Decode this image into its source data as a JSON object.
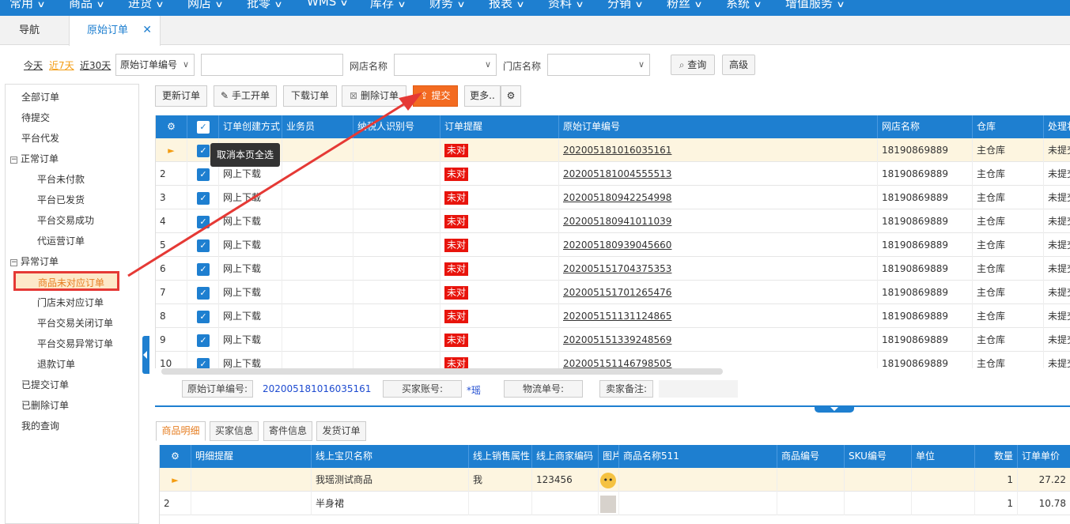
{
  "top_menu": [
    "常用",
    "商品",
    "进货",
    "网店",
    "批零",
    "WMS",
    "库存",
    "财务",
    "报表",
    "资料",
    "分销",
    "粉丝",
    "系统",
    "增值服务"
  ],
  "tabs": {
    "nav": "导航",
    "active": "原始订单",
    "close": "✕"
  },
  "filter": {
    "today": "今天",
    "last7": "近7天",
    "last30": "近30天",
    "field_select": "原始订单编号",
    "field_value": "",
    "shop_label": "网店名称",
    "store_label": "门店名称",
    "query": "查询",
    "advanced": "高级"
  },
  "sidebar": {
    "all": "全部订单",
    "pending": "待提交",
    "platform_proxy": "平台代发",
    "normal_group": "正常订单",
    "unpaid": "平台未付款",
    "shipped": "平台已发货",
    "success": "平台交易成功",
    "proxy_op": "代运营订单",
    "abnormal_group": "异常订单",
    "goods_unmatched": "商品未对应订单",
    "store_unmatched": "门店未对应订单",
    "closed": "平台交易关闭订单",
    "trade_abnormal": "平台交易异常订单",
    "refund": "退款订单",
    "submitted": "已提交订单",
    "deleted": "已删除订单",
    "my_query": "我的查询"
  },
  "toolbar": {
    "refresh": "更新订单",
    "manual": "手工开单",
    "download": "下载订单",
    "delete": "删除订单",
    "submit": "提交",
    "more": "更多.."
  },
  "grid": {
    "headers": [
      "订单创建方式",
      "业务员",
      "纳税人识别号",
      "订单提醒",
      "原始订单编号",
      "网店名称",
      "仓库",
      "处理状态"
    ],
    "rows": [
      {
        "no": "",
        "method": "",
        "tag": "未对",
        "order": "202005181016035161",
        "shop": "18190869889",
        "wh": "主仓库",
        "status": "未提交"
      },
      {
        "no": "2",
        "method": "网上下载",
        "tag": "未对",
        "order": "202005181004555513",
        "shop": "18190869889",
        "wh": "主仓库",
        "status": "未提交"
      },
      {
        "no": "3",
        "method": "网上下载",
        "tag": "未对",
        "order": "202005180942254998",
        "shop": "18190869889",
        "wh": "主仓库",
        "status": "未提交"
      },
      {
        "no": "4",
        "method": "网上下载",
        "tag": "未对",
        "order": "202005180941011039",
        "shop": "18190869889",
        "wh": "主仓库",
        "status": "未提交"
      },
      {
        "no": "5",
        "method": "网上下载",
        "tag": "未对",
        "order": "202005180939045660",
        "shop": "18190869889",
        "wh": "主仓库",
        "status": "未提交"
      },
      {
        "no": "6",
        "method": "网上下载",
        "tag": "未对",
        "order": "202005151704375353",
        "shop": "18190869889",
        "wh": "主仓库",
        "status": "未提交"
      },
      {
        "no": "7",
        "method": "网上下载",
        "tag": "未对",
        "order": "202005151701265476",
        "shop": "18190869889",
        "wh": "主仓库",
        "status": "未提交"
      },
      {
        "no": "8",
        "method": "网上下载",
        "tag": "未对",
        "order": "202005151131124865",
        "shop": "18190869889",
        "wh": "主仓库",
        "status": "未提交"
      },
      {
        "no": "9",
        "method": "网上下载",
        "tag": "未对",
        "order": "202005151339248569",
        "shop": "18190869889",
        "wh": "主仓库",
        "status": "未提交"
      },
      {
        "no": "10",
        "method": "网上下载",
        "tag": "未对",
        "order": "202005151146798505",
        "shop": "18190869889",
        "wh": "主仓库",
        "status": "未提交"
      }
    ]
  },
  "tooltip": "取消本页全选",
  "detail": {
    "order_label": "原始订单编号:",
    "order_value": "202005181016035161",
    "buyer_label": "买家账号:",
    "buyer_value": "*瑶",
    "logistics_label": "物流单号:",
    "seller_note_label": "卖家备注:"
  },
  "bottom_tabs": [
    "商品明细",
    "买家信息",
    "寄件信息",
    "发货订单"
  ],
  "bottom_grid": {
    "headers": [
      "明细提醒",
      "线上宝贝名称",
      "线上销售属性",
      "线上商家编码",
      "图片",
      "商品名称511",
      "商品编号",
      "SKU编号",
      "单位",
      "数量",
      "订单单价"
    ],
    "rows": [
      {
        "no": "",
        "name": "我瑶测试商品",
        "attr": "我",
        "code": "123456",
        "qty": "1",
        "price": "27.22"
      },
      {
        "no": "2",
        "name": "半身裙",
        "attr": "",
        "code": "",
        "qty": "1",
        "price": "10.78"
      }
    ]
  },
  "colors": {
    "accent": "#1e7fd0",
    "submit": "#f36b21",
    "tag": "#e8140c",
    "annot": "#e53935"
  }
}
